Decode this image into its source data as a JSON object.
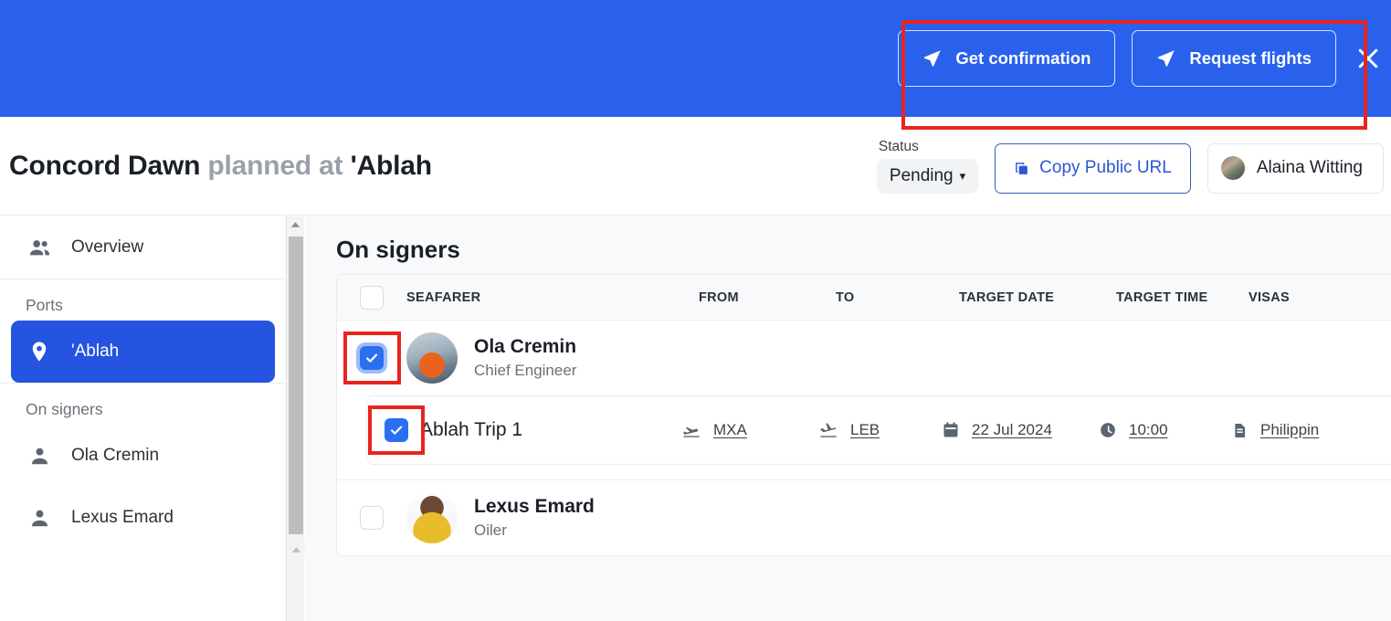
{
  "action_bar": {
    "buttons": [
      {
        "label": "Get confirmation",
        "icon": "send-icon"
      },
      {
        "label": "Request flights",
        "icon": "send-icon"
      }
    ],
    "close_icon": "close-icon",
    "background_color": "#2961ec"
  },
  "header": {
    "title_main": "Concord Dawn",
    "title_muted": "planned at",
    "title_place": "'Ablah",
    "status_label": "Status",
    "status_value": "Pending",
    "status_chevron": "chevron-down-icon",
    "copy_url_label": "Copy Public URL",
    "copy_url_icon": "copy-icon",
    "user_name": "Alaina Witting",
    "user_avatar": "avatar"
  },
  "sidebar": {
    "overview_label": "Overview",
    "overview_icon": "people-icon",
    "ports_caption": "Ports",
    "ports": [
      {
        "label": "'Ablah",
        "icon": "map-pin-icon",
        "active": true
      }
    ],
    "signers_caption": "On signers",
    "signers": [
      {
        "label": "Ola Cremin",
        "icon": "person-icon"
      },
      {
        "label": "Lexus Emard",
        "icon": "person-icon"
      }
    ],
    "active_color": "#2454e0"
  },
  "main": {
    "section_title": "On signers",
    "table": {
      "columns": [
        "SEAFARER",
        "FROM",
        "TO",
        "TARGET DATE",
        "TARGET TIME",
        "VISAS"
      ],
      "header_checkbox_checked": false,
      "rows": [
        {
          "name": "Ola Cremin",
          "role": "Chief Engineer",
          "checked": true,
          "focused": true,
          "trips": [
            {
              "name": "'Ablah Trip 1",
              "checked": true,
              "from": "MXA",
              "from_icon": "flight-takeoff-icon",
              "to": "LEB",
              "to_icon": "flight-landing-icon",
              "target_date": "22 Jul 2024",
              "date_icon": "calendar-icon",
              "target_time": "10:00",
              "time_icon": "clock-icon",
              "visa": "Philippin",
              "visa_icon": "document-icon"
            }
          ]
        },
        {
          "name": "Lexus Emard",
          "role": "Oiler",
          "checked": false,
          "focused": false,
          "trips": []
        }
      ]
    }
  },
  "scrollbar": {
    "up_arrow_icon": "chevron-up-icon",
    "down_arrow_icon": "chevron-down-icon"
  }
}
